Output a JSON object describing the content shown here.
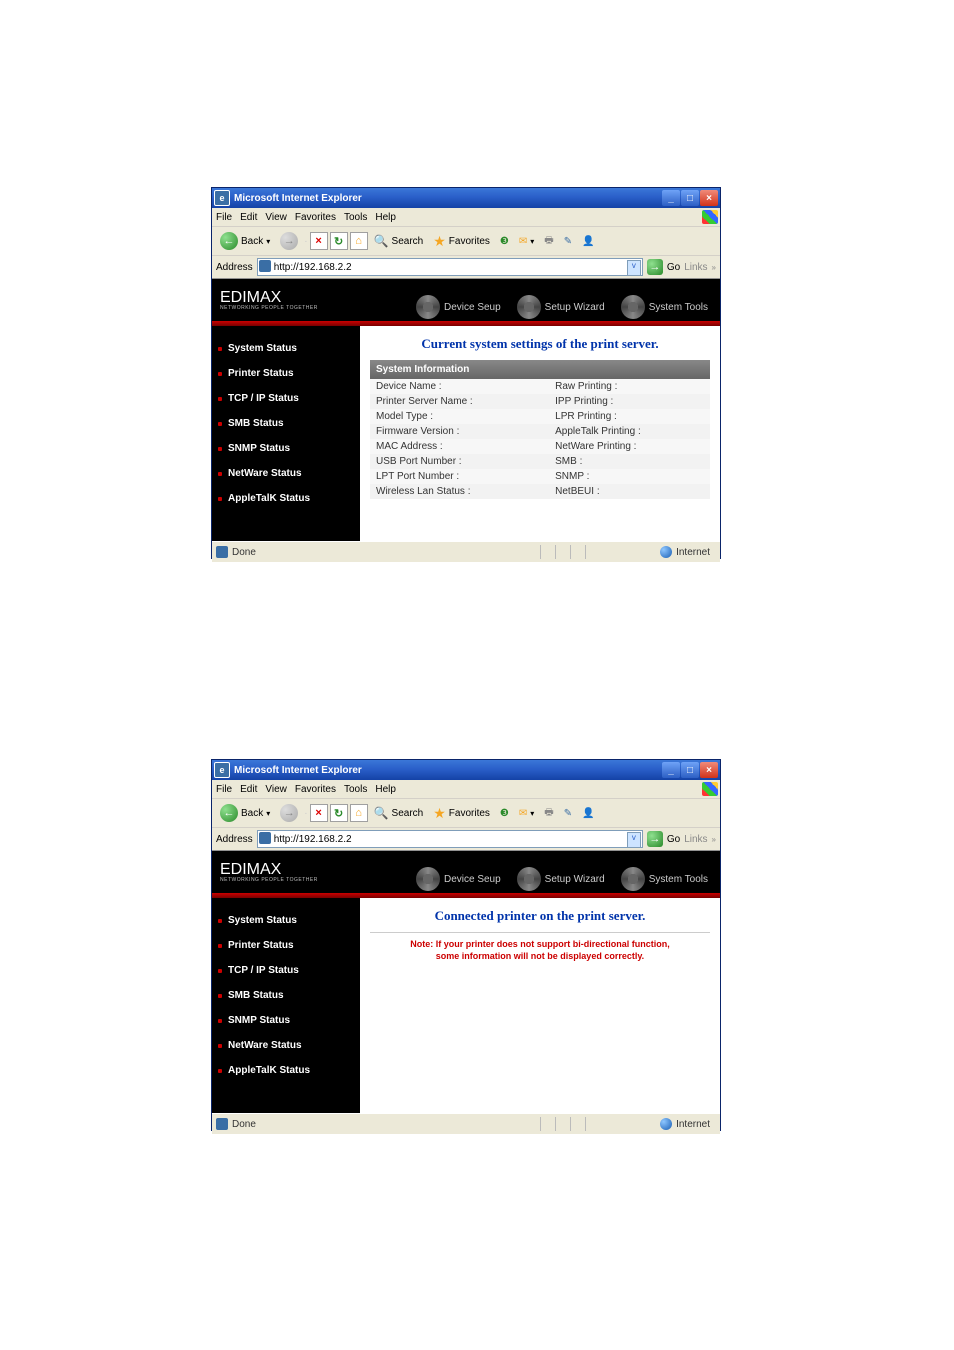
{
  "window": {
    "title": "Microsoft Internet Explorer",
    "menus": [
      "File",
      "Edit",
      "View",
      "Favorites",
      "Tools",
      "Help"
    ],
    "toolbar": {
      "back": "Back",
      "search": "Search",
      "favorites": "Favorites"
    },
    "address_label": "Address",
    "address_url": "http://192.168.2.2",
    "go_label": "Go",
    "links_label": "Links",
    "status_done": "Done",
    "status_zone": "Internet"
  },
  "edimax": {
    "logo_main": "EDIMAX",
    "logo_sub": "NETWORKING PEOPLE TOGETHER",
    "tabs": [
      "Device Seup",
      "Setup Wizard",
      "System Tools"
    ],
    "sidebar": [
      "System Status",
      "Printer Status",
      "TCP / IP Status",
      "SMB Status",
      "SNMP Status",
      "NetWare Status",
      "AppleTalK Status"
    ]
  },
  "page1": {
    "heading": "Current system settings of the print server.",
    "section_header": "System Information",
    "rows_left": [
      "Device Name :",
      "Printer Server Name :",
      "Model Type :",
      "Firmware Version :",
      "MAC Address :",
      "USB Port Number :",
      "LPT Port Number :",
      "Wireless Lan Status :"
    ],
    "rows_right": [
      "Raw Printing :",
      "IPP Printing :",
      "LPR Printing :",
      "AppleTalk Printing :",
      "NetWare Printing :",
      "SMB :",
      "SNMP :",
      "NetBEUI :"
    ]
  },
  "page2": {
    "heading": "Connected printer on the print server.",
    "note_line1": "Note: If your printer does not support bi-directional function,",
    "note_line2": "some information will not be displayed correctly."
  }
}
